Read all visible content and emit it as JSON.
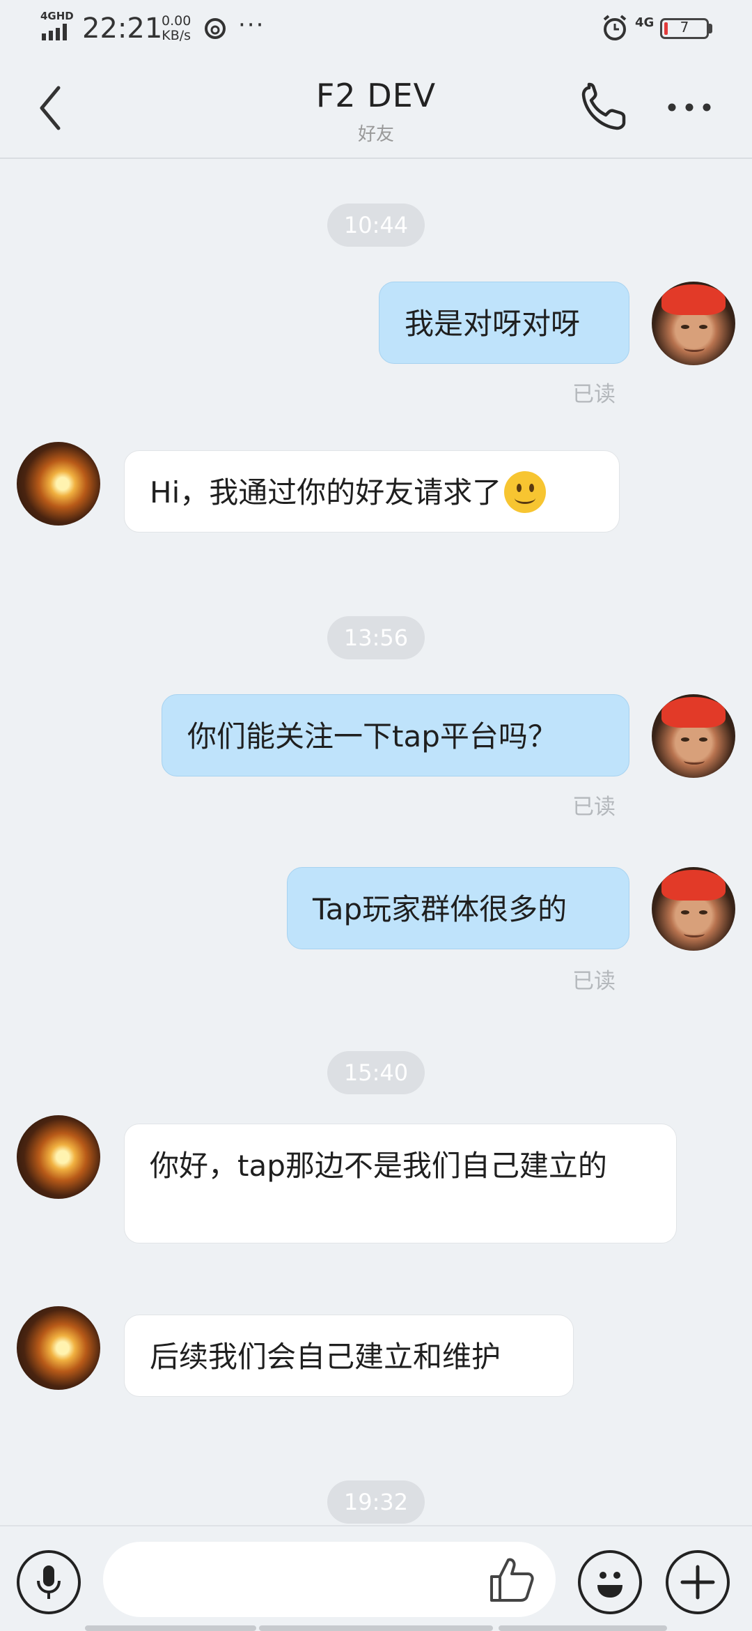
{
  "status_bar": {
    "network": "4GHD",
    "time": "22:21",
    "speed_value": "0.00",
    "speed_unit": "KB/s",
    "more": "···",
    "network_right": "4G",
    "battery": "7",
    "battery_color": "#e23b3b"
  },
  "header": {
    "title": "F2 DEV",
    "subtitle": "好友"
  },
  "messages": {
    "time_1": "10:44",
    "msg_1": "我是对呀对呀",
    "read_1": "已读",
    "msg_2": "Hi，我通过你的好友请求了",
    "time_2": "13:56",
    "msg_3": "你们能关注一下tap平台吗？",
    "read_3": "已读",
    "msg_4": "Tap玩家群体很多的",
    "read_4": "已读",
    "time_3": "15:40",
    "msg_5": "你好，tap那边不是我们自己建立的",
    "msg_6": "后续我们会自己建立和维护",
    "time_4": "19:32"
  },
  "colors": {
    "sent_bubble": "#bfe3fb",
    "received_bubble": "#ffffff",
    "background": "#eef1f4"
  },
  "icons": [
    "back-icon",
    "phone-icon",
    "more-icon",
    "microphone-icon",
    "thumbs-up-icon",
    "emoji-icon",
    "plus-icon",
    "smile-emoji"
  ]
}
